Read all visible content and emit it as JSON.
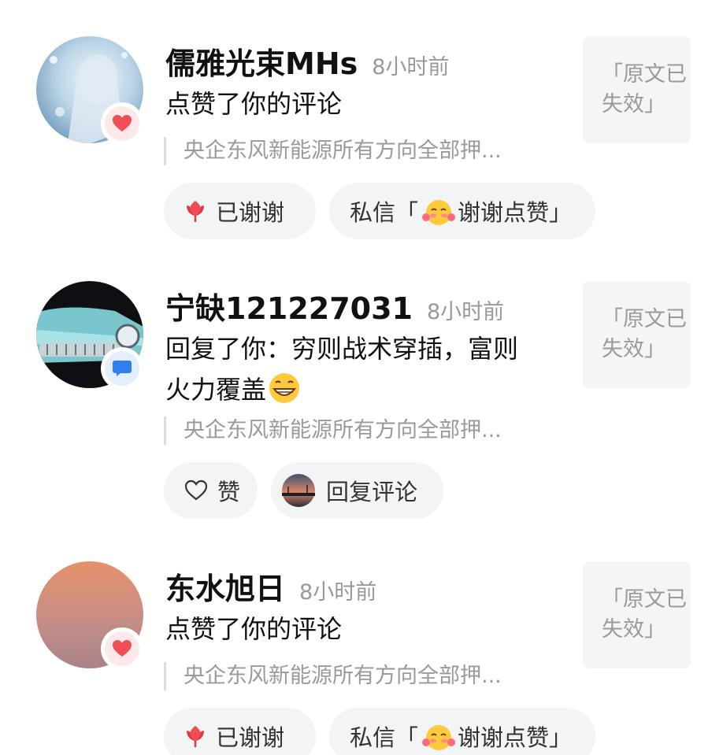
{
  "notifications": [
    {
      "username": "儒雅光束MHs",
      "time": "8小时前",
      "action_text": "点赞了你的评论",
      "quote": "央企东风新能源所有方向全部押...",
      "badge_icon": "heart-icon",
      "buttons": [
        {
          "icon": "flower-icon",
          "label": "已谢谢"
        },
        {
          "icon": "blush-emoji-icon",
          "label_prefix": "私信「",
          "label_suffix": "谢谢点赞」"
        }
      ],
      "thumbnail_line1": "「原文已",
      "thumbnail_line2": "失效」"
    },
    {
      "username": "宁缺121227031",
      "time": "8小时前",
      "action_text": "回复了你：穷则战术穿插，富则火力覆盖",
      "action_emoji": "grin-emoji-icon",
      "quote": "央企东风新能源所有方向全部押...",
      "badge_icon": "chat-bubble-icon",
      "buttons": [
        {
          "icon": "heart-outline-icon",
          "label": "赞"
        },
        {
          "icon": "my-avatar-icon",
          "label": "回复评论"
        }
      ],
      "thumbnail_line1": "「原文已",
      "thumbnail_line2": "失效」"
    },
    {
      "username": "东水旭日",
      "time": "8小时前",
      "action_text": "点赞了你的评论",
      "quote": "央企东风新能源所有方向全部押...",
      "badge_icon": "heart-icon",
      "buttons": [
        {
          "icon": "flower-icon",
          "label": "已谢谢"
        },
        {
          "icon": "blush-emoji-icon",
          "label_prefix": "私信「",
          "label_suffix": "谢谢点赞」"
        }
      ],
      "thumbnail_line1": "「原文已",
      "thumbnail_line2": "失效」"
    }
  ],
  "colors": {
    "like_red": "#f04d55",
    "reply_blue": "#2f80ed",
    "muted_text": "#999999",
    "pill_bg": "#f3f4f6"
  }
}
